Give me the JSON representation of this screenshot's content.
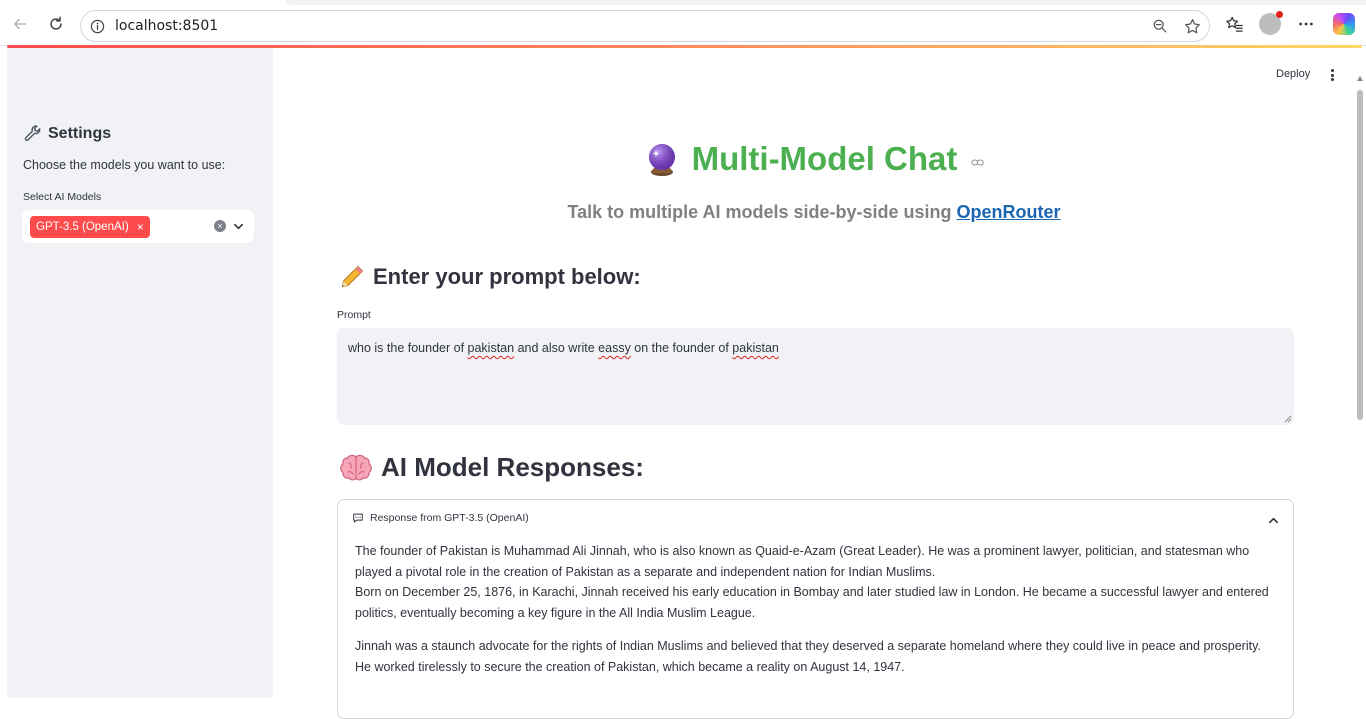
{
  "browser": {
    "url": "localhost:8501"
  },
  "sidebar": {
    "title": "Settings",
    "description": "Choose the models you want to use:",
    "select_label": "Select AI Models",
    "selected_models": [
      "GPT-3.5 (OpenAI)"
    ]
  },
  "header": {
    "deploy_label": "Deploy"
  },
  "main": {
    "title": "Multi-Model Chat",
    "subtitle_prefix": "Talk to multiple AI models side-by-side using ",
    "subtitle_link": "OpenRouter",
    "prompt_heading": "Enter your prompt below:",
    "prompt_label": "Prompt",
    "prompt_parts": [
      "who is the founder of ",
      "pakistan",
      " and also write ",
      "eassy",
      " on the founder of ",
      "pakistan"
    ],
    "responses_heading": "AI Model Responses:",
    "response": {
      "header": "Response from GPT-3.5 (OpenAI)",
      "paragraph1_line1": "The founder of Pakistan is Muhammad Ali Jinnah, who is also known as Quaid-e-Azam (Great Leader). He was a prominent lawyer, politician, and statesman who played a pivotal role in the creation of Pakistan as a separate and independent nation for Indian Muslims.",
      "paragraph1_line2": "Born on December 25, 1876, in Karachi, Jinnah received his early education in Bombay and later studied law in London. He became a successful lawyer and entered politics, eventually becoming a key figure in the All India Muslim League.",
      "paragraph2": "Jinnah was a staunch advocate for the rights of Indian Muslims and believed that they deserved a separate homeland where they could live in peace and prosperity. He worked tirelessly to secure the creation of Pakistan, which became a reality on August 14, 1947."
    }
  },
  "colors": {
    "accent": "#ff4b4b",
    "title_green": "#4caf50",
    "link_blue": "#1a66b3",
    "sidebar_bg": "#f0f2f6"
  }
}
